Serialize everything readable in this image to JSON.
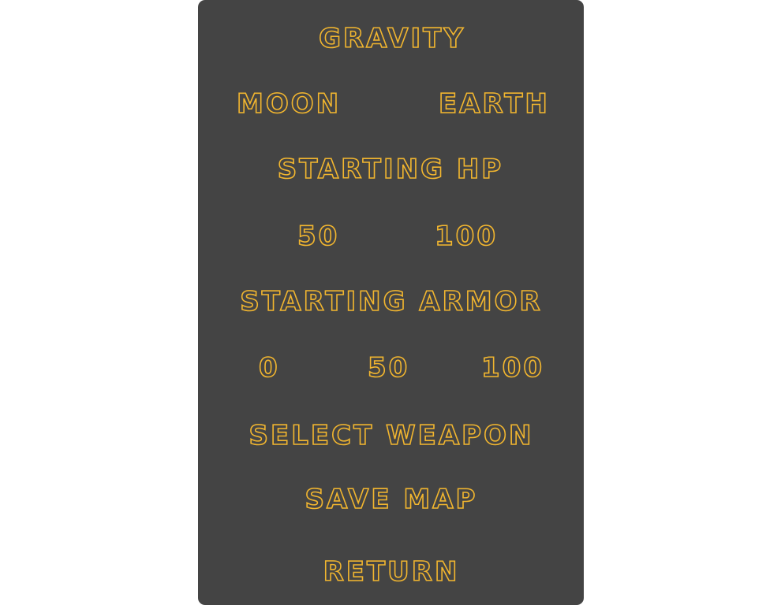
{
  "menu": {
    "gravity": {
      "heading": "GRAVITY",
      "options": [
        "MOON",
        "EARTH"
      ]
    },
    "starting_hp": {
      "heading": "STARTING HP",
      "options": [
        "50",
        "100"
      ]
    },
    "starting_armor": {
      "heading": "STARTING ARMOR",
      "options": [
        "0",
        "50",
        "100"
      ]
    },
    "select_weapon": "SELECT WEAPON",
    "save_map": "SAVE MAP",
    "return": "RETURN"
  },
  "colors": {
    "panel": "#444444",
    "text": "#f2b62f",
    "background": "#ffffff"
  }
}
